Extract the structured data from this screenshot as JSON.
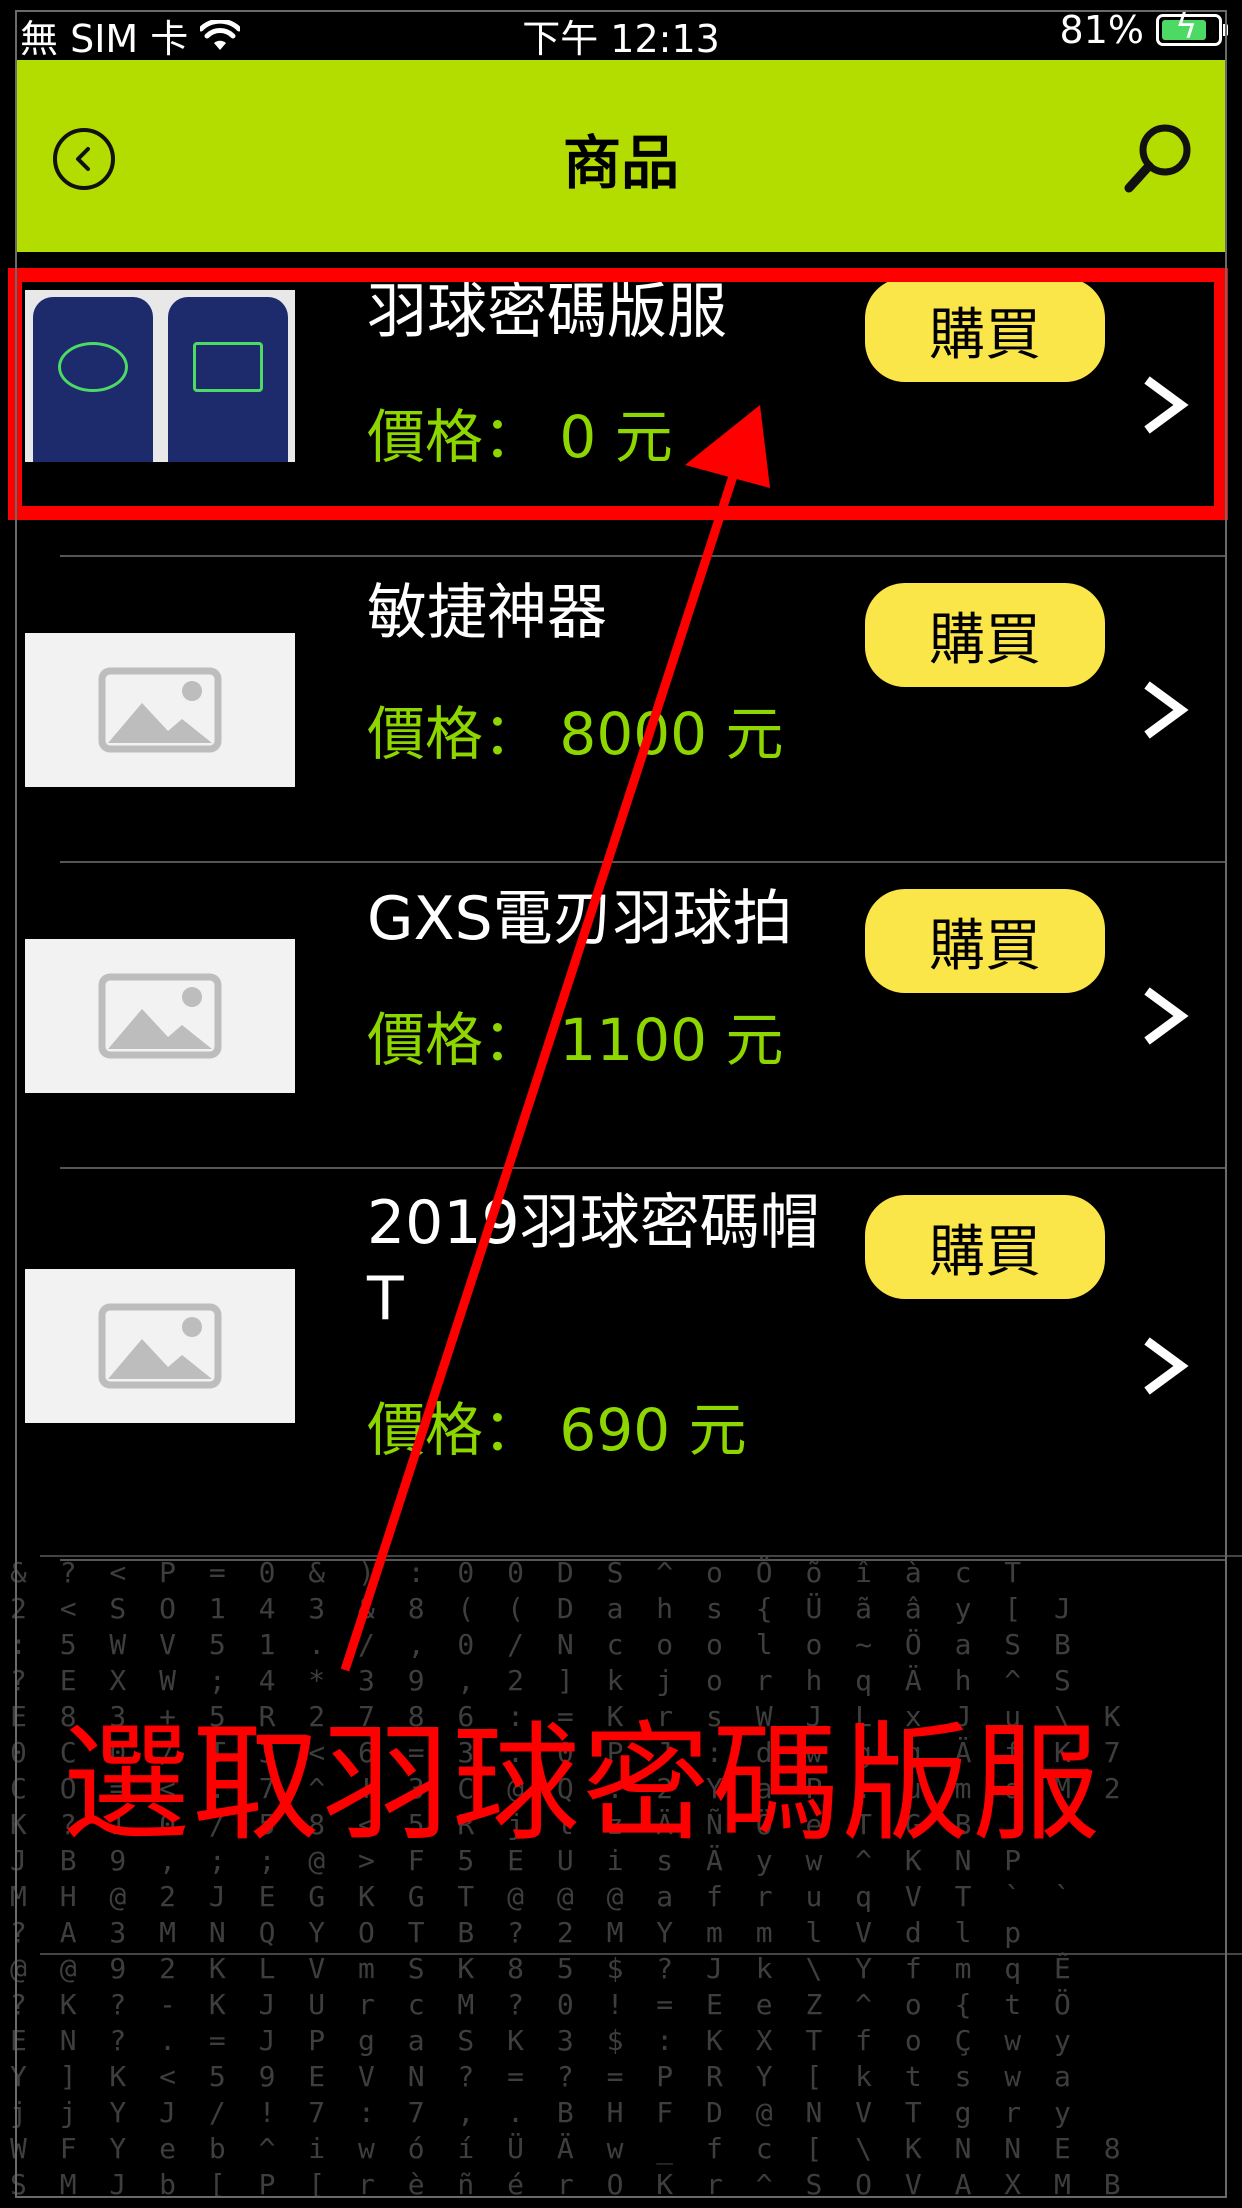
{
  "status_bar": {
    "carrier": "無 SIM 卡",
    "time": "下午 12:13",
    "battery": "81%",
    "battery_level": 0.81
  },
  "nav": {
    "title": "商品"
  },
  "products": [
    {
      "name": "羽球密碼版服",
      "price": "價格： 0 元",
      "buy_label": "購買"
    },
    {
      "name": "敏捷神器",
      "price": "價格： 8000 元",
      "buy_label": "購買"
    },
    {
      "name": "GXS電刃羽球拍",
      "price": "價格： 1100 元",
      "buy_label": "購買"
    },
    {
      "name": "2019羽球密碼帽T",
      "price": "價格： 690 元",
      "buy_label": "購買"
    }
  ],
  "annotation": {
    "text": "選取羽球密碼版服",
    "color": "#ff0000"
  },
  "colors": {
    "nav_bg": "#b3dc00",
    "price": "#8ed600",
    "buy_button": "#fbe64a"
  }
}
